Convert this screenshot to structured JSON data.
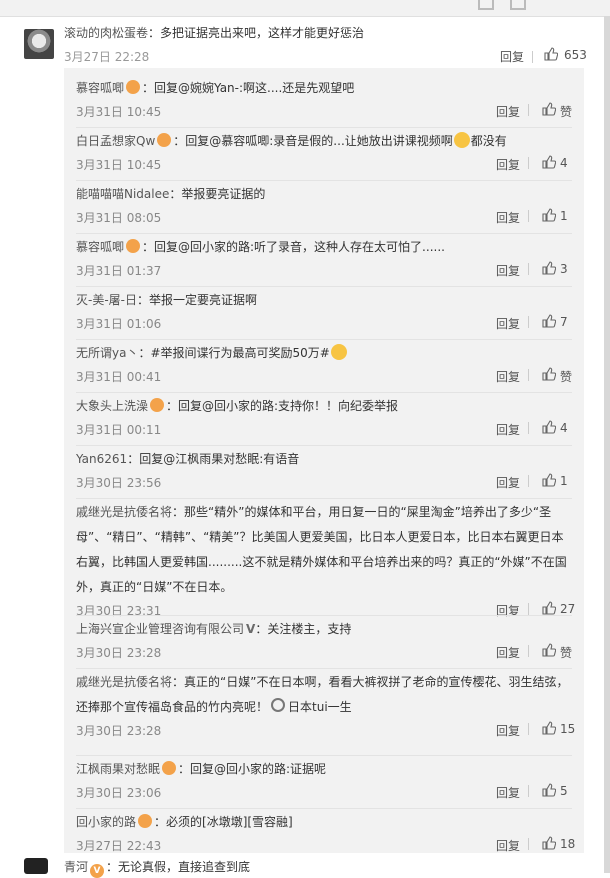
{
  "main_comment": {
    "user": "滚动的肉松蛋卷",
    "text": "：多把证据亮出来吧，这样才能更好惩治",
    "time": "3月27日 22:28",
    "reply_label": "回复",
    "likes": "653"
  },
  "replies": [
    {
      "user": "慕容呱唧",
      "text": "：回复@婉婉Yan-:啊这....还是先观望吧",
      "time": "3月31日 10:45",
      "reply": "回复",
      "likes": "赞"
    },
    {
      "user": "白日孟想家Qw",
      "text": "：回复@慕容呱唧:录音是假的...让她放出讲课视频啊",
      "text_tail": "都没有",
      "time": "3月31日 10:45",
      "reply": "回复",
      "likes": "4"
    },
    {
      "user": "能喵喵喵Nidalee",
      "text": "：举报要亮证据的",
      "time": "3月31日 08:05",
      "reply": "回复",
      "likes": "1"
    },
    {
      "user": "慕容呱唧",
      "text": "：回复@回小家的路:听了录音，这种人存在太可怕了......",
      "time": "3月31日 01:37",
      "reply": "回复",
      "likes": "3"
    },
    {
      "user": "灭-美-屠-日",
      "text": "：举报一定要亮证据啊",
      "time": "3月31日 01:06",
      "reply": "回复",
      "likes": "7"
    },
    {
      "user": "无所谓ya丶",
      "text": "：#举报间谍行为最高可奖励50万#",
      "time": "3月31日 00:41",
      "reply": "回复",
      "likes": "赞"
    },
    {
      "user": "大象头上洗澡",
      "text": "：回复@回小家的路:支持你！！向纪委举报",
      "time": "3月31日 00:11",
      "reply": "回复",
      "likes": "4"
    },
    {
      "user": "Yan6261",
      "text": "：回复@江枫雨果对愁眠:有语音",
      "time": "3月30日 23:56",
      "reply": "回复",
      "likes": "1"
    },
    {
      "user": "戚继光是抗倭名将",
      "text": "：那些“精外”的媒体和平台，用日复一日的“屎里淘金”培养出了多少“圣母”、“精日”、“精韩”、“精美”？比美国人更爱美国，比日本人更爱日本，比日本右翼更日本右翼，比韩国人更爱韩国.........这不就是精外媒体和平台培养出来的吗？真正的“外媒”不在国外，真正的“日媒”不在日本。",
      "time": "3月30日 23:31",
      "reply": "回复",
      "likes": "27"
    },
    {
      "user": "上海兴宣企业管理咨询有限公司",
      "badge": "V",
      "text": "：关注楼主，支持",
      "time": "3月30日 23:28",
      "reply": "回复",
      "likes": "赞"
    },
    {
      "user": "戚继光是抗倭名将",
      "text": "：真正的“日媒”不在日本啊，看看大裤衩拼了老命的宣传樱花、羽生结弦，还捧那个宣传福岛食品的竹内亮呢！",
      "link_text": "日本tui一生",
      "time": "3月30日 23:28",
      "reply": "回复",
      "likes": "15"
    },
    {
      "user": "江枫雨果对愁眠",
      "text": "：回复@回小家的路:证据呢",
      "time": "3月30日 23:06",
      "reply": "回复",
      "likes": "5"
    },
    {
      "user": "回小家的路",
      "text": "：必须的[冰墩墩][雪容融]",
      "time": "3月27日 22:43",
      "reply": "回复",
      "likes": "18"
    }
  ],
  "next_comment": {
    "user": "青河",
    "text": "：无论真假，直接追查到底"
  }
}
